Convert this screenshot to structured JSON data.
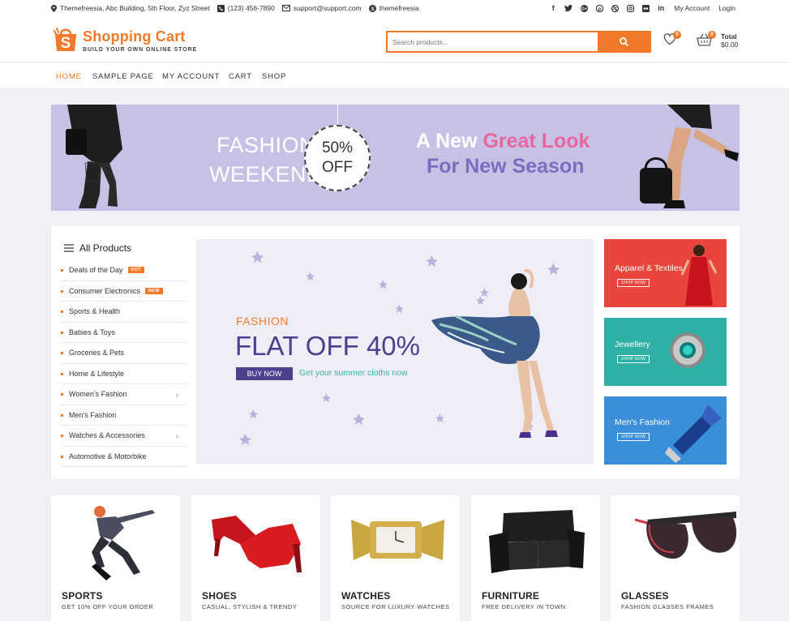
{
  "topbar": {
    "address": "Themefreesia, Abc Building, 5th Floor, Zyz Street",
    "phone": "(123) 456-7890",
    "email": "support@support.com",
    "skype": "themefreesia",
    "social_icons": [
      "facebook-icon",
      "twitter-icon",
      "google-plus-icon",
      "pinterest-icon",
      "dribbble-icon",
      "instagram-icon",
      "flickr-icon",
      "linkedin-icon"
    ],
    "my_account": "My Account",
    "login": "Login"
  },
  "header": {
    "logo_letter": "S",
    "logo_title": "Shopping Cart",
    "logo_tagline": "BUILD YOUR OWN ONLINE STORE",
    "search_placeholder": "Search products...",
    "wishlist_count": "0",
    "cart_count": "0",
    "total_label": "Total",
    "total_amount": "$0.00"
  },
  "nav": {
    "items": [
      "HOME",
      "SAMPLE PAGE",
      "MY ACCOUNT",
      "CART",
      "SHOP"
    ]
  },
  "banner": {
    "left_line1": "FASHION",
    "left_line2": "WEEKEND",
    "circle_line1": "50%",
    "circle_line2": "OFF",
    "right_part1": "A New",
    "right_part2": "Great Look",
    "right_line2": "For New Season"
  },
  "categories": {
    "title": "All Products",
    "items": [
      {
        "label": "Deals of the Day",
        "tag": "HOT"
      },
      {
        "label": "Consumer Electronics",
        "tag": "NEW"
      },
      {
        "label": "Sports & Health"
      },
      {
        "label": "Babies & Toys"
      },
      {
        "label": "Groceries & Pets"
      },
      {
        "label": "Home & Lifestyle"
      },
      {
        "label": "Women's Fashion",
        "chevron": true
      },
      {
        "label": "Men's Fashion"
      },
      {
        "label": "Watches & Accessories",
        "chevron": true
      },
      {
        "label": "Automotive & Motorbike"
      }
    ]
  },
  "slider": {
    "kicker": "FASHION",
    "headline": "FLAT OFF 40%",
    "button": "BUY NOW",
    "subtext": "Get your summer cloths now"
  },
  "promos": [
    {
      "title": "Apparel & Textiles",
      "button": "SHOP NOW",
      "color": "#e8453c"
    },
    {
      "title": "Jewellery",
      "button": "SHOP NOW",
      "color": "#2fb0a6"
    },
    {
      "title": "Men's Fashion",
      "button": "SHOP NOW",
      "color": "#3a8fd8"
    }
  ],
  "products": [
    {
      "name": "SPORTS",
      "sub": "GET 10% OFF YOUR ORDER"
    },
    {
      "name": "SHOES",
      "sub": "CASUAL, STYLISH & TRENDY"
    },
    {
      "name": "WATCHES",
      "sub": "SOURCE FOR LUXURY WATCHES"
    },
    {
      "name": "FURNITURE",
      "sub": "FREE DELIVERY IN TOWN"
    },
    {
      "name": "GLASSES",
      "sub": "FASHION GLASSES FRAMES"
    }
  ],
  "colors": {
    "accent": "#f07a2a",
    "brand_purple": "#4b3f8e",
    "teal": "#30b4a8",
    "pink": "#e8669f"
  }
}
